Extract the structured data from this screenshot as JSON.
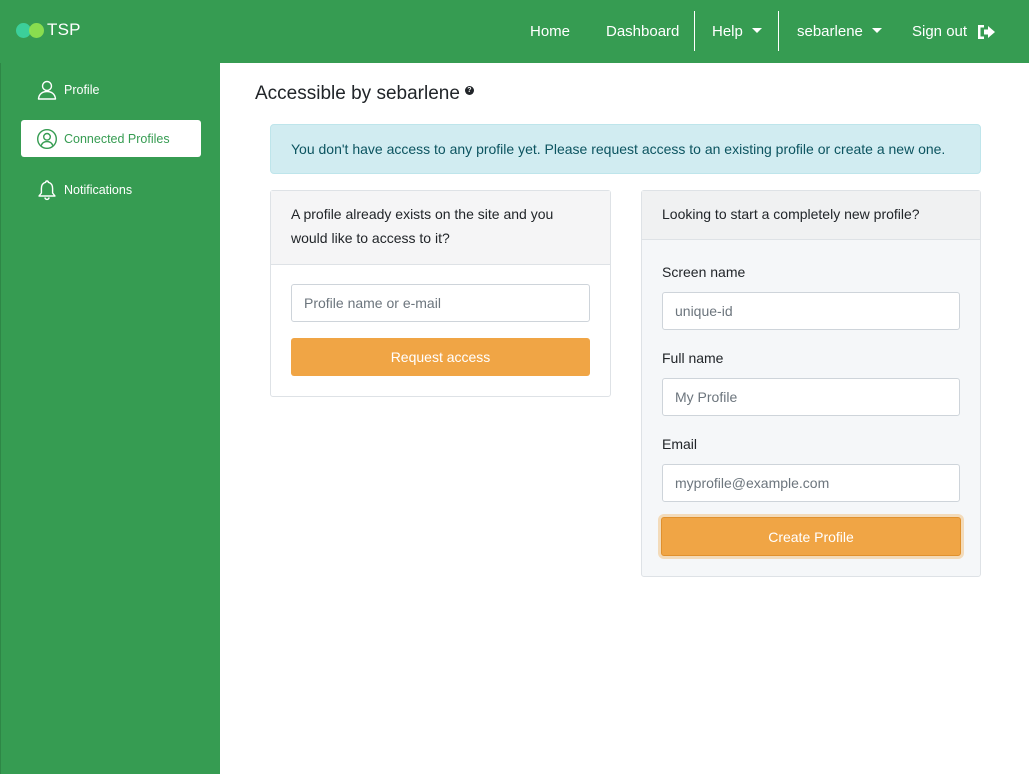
{
  "brand": {
    "name": "TSP"
  },
  "nav": {
    "home": "Home",
    "dashboard": "Dashboard",
    "help": "Help",
    "user": "sebarlene",
    "signout": "Sign out"
  },
  "sidebar": {
    "items": [
      {
        "label": "Profile",
        "icon": "user-icon"
      },
      {
        "label": "Connected Profiles",
        "icon": "user-circle-icon",
        "active": true
      },
      {
        "label": "Notifications",
        "icon": "bell-icon"
      }
    ]
  },
  "main": {
    "title": "Accessible by sebarlene",
    "alert": "You don't have access to any profile yet. Please request access to an existing profile or create a new one.",
    "request_card": {
      "header": "A profile already exists on the site and you would like to access to it?",
      "input_placeholder": "Profile name or e-mail",
      "button": "Request access"
    },
    "create_card": {
      "header": "Looking to start a completely new profile?",
      "screen_name_label": "Screen name",
      "screen_name_placeholder": "unique-id",
      "full_name_label": "Full name",
      "full_name_placeholder": "My Profile",
      "email_label": "Email",
      "email_placeholder": "myprofile@example.com",
      "button": "Create Profile"
    }
  },
  "colors": {
    "primary_green": "#369c52",
    "accent_orange": "#f0a545",
    "alert_bg": "#d1ecf1",
    "alert_text": "#0c5460"
  }
}
